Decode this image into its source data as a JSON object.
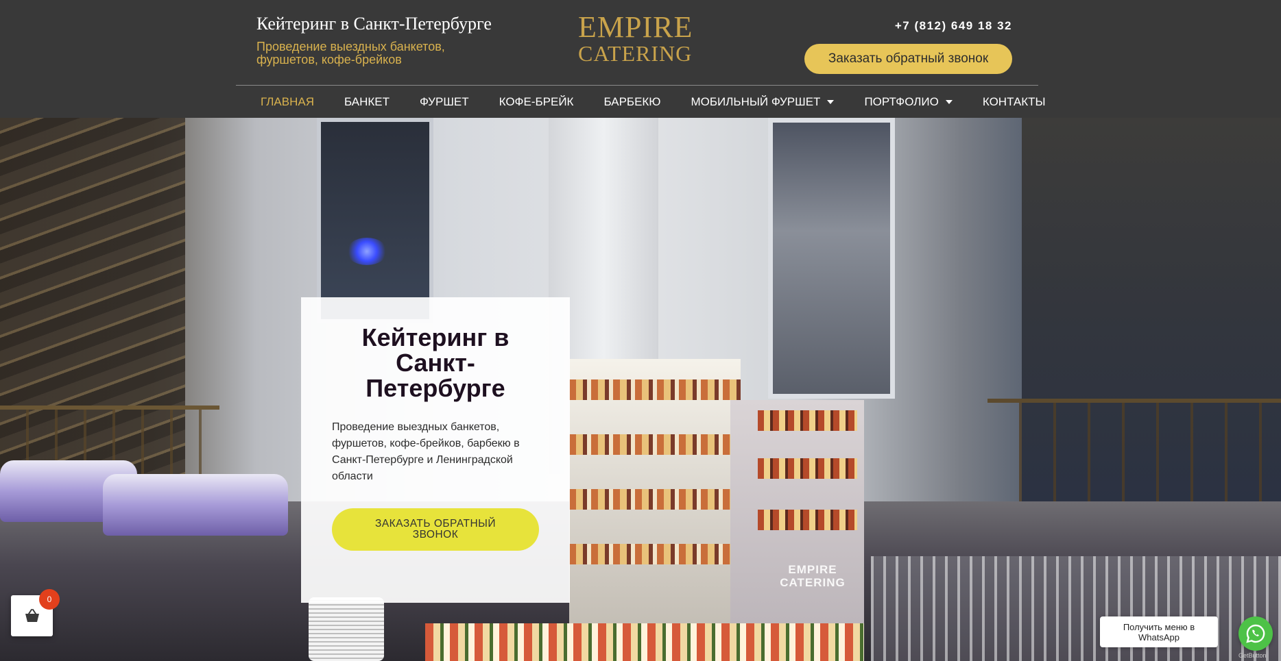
{
  "header": {
    "title": "Кейтеринг в Санкт-Петербурге",
    "subtitle": "Проведение выездных банкетов, фуршетов, кофе-брейков",
    "logo": {
      "line1": "EMPIRE",
      "line2": "CATERING"
    },
    "phone": "+7 (812) 649 18 32",
    "callback_label": "Заказать обратный звонок"
  },
  "nav": {
    "items": [
      {
        "label": "Главная",
        "active": true
      },
      {
        "label": "Банкет"
      },
      {
        "label": "Фуршет"
      },
      {
        "label": "Кофе-брейк"
      },
      {
        "label": "Барбекю"
      },
      {
        "label": "Мобильный фуршет",
        "dropdown": true
      },
      {
        "label": "Портфолио",
        "dropdown": true
      },
      {
        "label": "Контакты"
      }
    ]
  },
  "hero": {
    "card_title": "Кейтеринг в Санкт-Петербурге",
    "card_description": "Проведение выездных банкетов, фуршетов, кофе-брейков, барбекю в Санкт-Петербурге и Ленинградской области",
    "card_button": "ЗАКАЗАТЬ ОБРАТНЫЙ ЗВОНОК",
    "stand_logo": {
      "line1": "EMPIRE",
      "line2": "CATERING"
    }
  },
  "widgets": {
    "cart_icon": "basket-icon",
    "cart_count": "0",
    "whatsapp_tooltip": "Получить меню в WhatsApp",
    "whatsapp_icon": "whatsapp-icon",
    "getbutton_label": "GetButton"
  },
  "colors": {
    "header_bg": "#393939",
    "accent_gold": "#d9b24e",
    "callback_button": "#e7c558",
    "hero_button": "#e7e33b",
    "cart_badge": "#e2401c",
    "whatsapp_green": "#4dc247"
  }
}
